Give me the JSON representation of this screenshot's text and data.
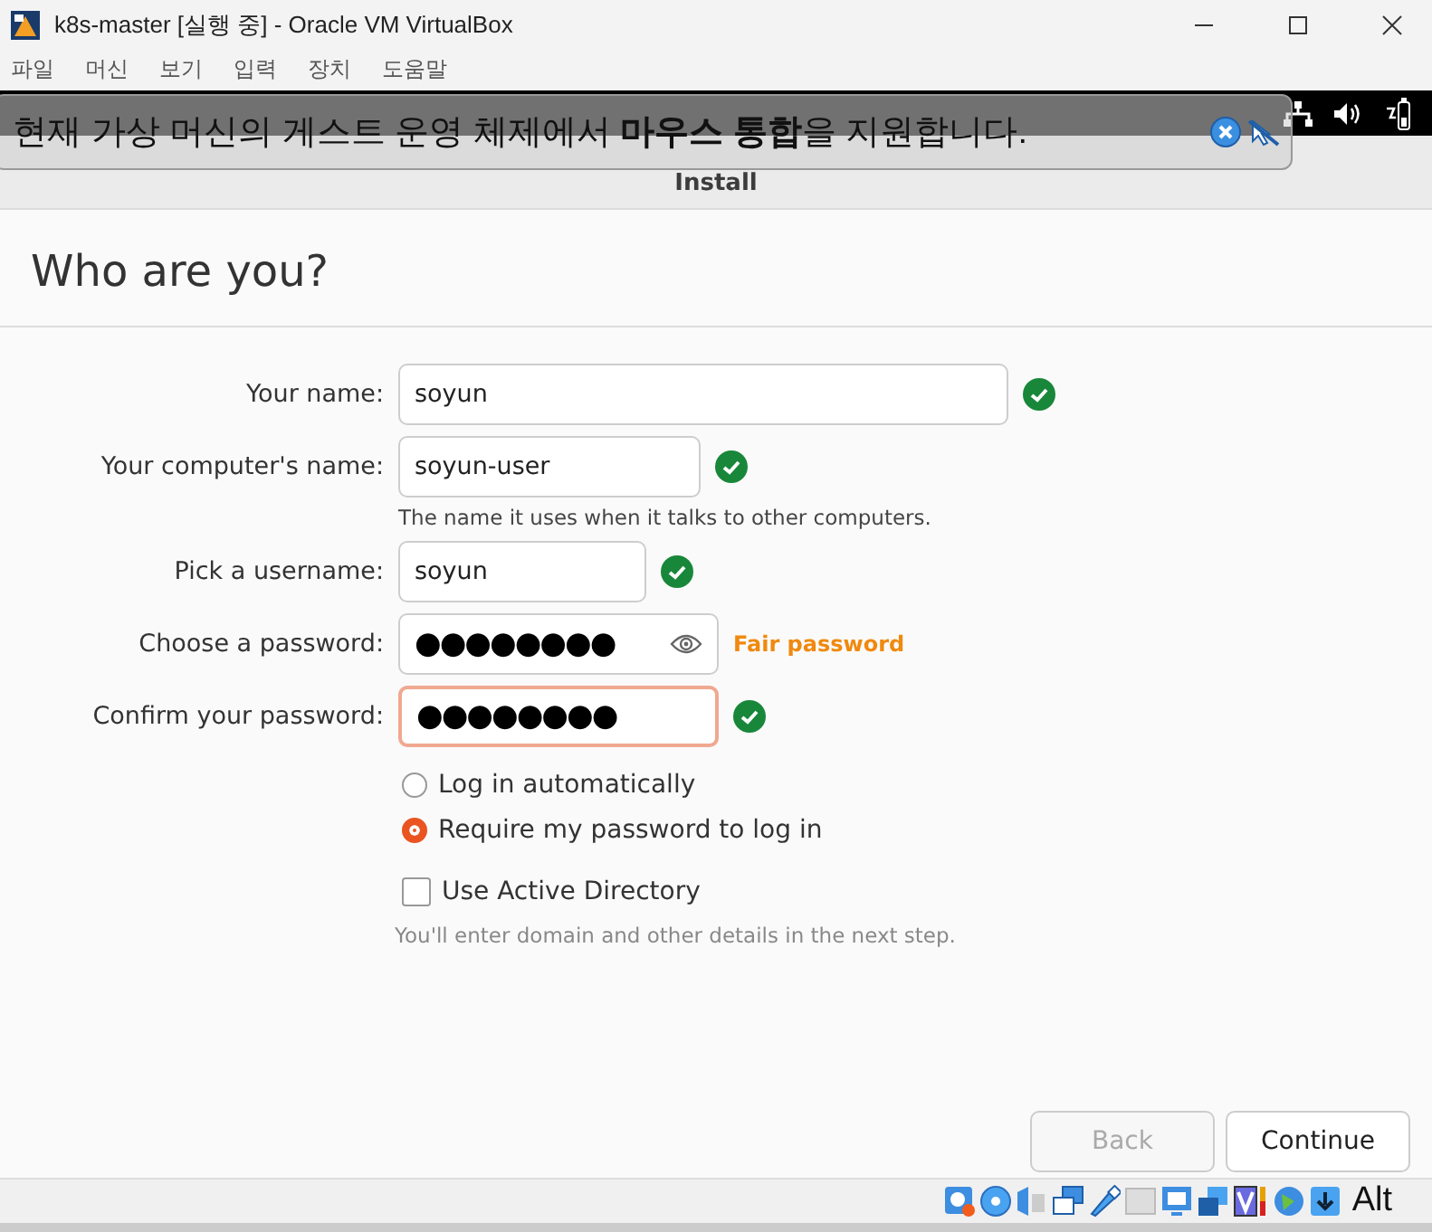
{
  "window": {
    "title": "k8s-master [실행 중] - Oracle VM VirtualBox"
  },
  "menu": [
    "파일",
    "머신",
    "보기",
    "입력",
    "장치",
    "도움말"
  ],
  "notification": {
    "text": "현재 가상 머신의 게스트 운영 체제에서 **마우스 통합**을 지원합니다."
  },
  "installer": {
    "title": "Install",
    "heading": "Who are you?",
    "fields": [
      {
        "label": "Your name:",
        "value": "soyun",
        "kind": "text",
        "valid": true,
        "focused": false
      },
      {
        "label": "Your computer's name:",
        "value": "soyun-user",
        "kind": "text",
        "valid": true,
        "focused": false,
        "hint": "The name it uses when it talks to other computers."
      },
      {
        "label": "Pick a username:",
        "value": "soyun",
        "kind": "text",
        "valid": true,
        "focused": false
      },
      {
        "label": "Choose a password:",
        "value": "●●●●●●●●",
        "kind": "password",
        "valid": false,
        "focused": false,
        "strength": "Fair password"
      },
      {
        "label": "Confirm your password:",
        "value": "●●●●●●●●",
        "kind": "text",
        "valid": true,
        "focused": true
      }
    ],
    "login_options": [
      {
        "label": "Log in automatically",
        "selected": false
      },
      {
        "label": "Require my password to log in",
        "selected": true
      }
    ],
    "active_directory": {
      "label": "Use Active Directory",
      "checked": false,
      "hint": "You'll enter domain and other details in the next step."
    },
    "buttons": [
      {
        "label": "Back",
        "disabled": true
      },
      {
        "label": "Continue",
        "disabled": false
      }
    ]
  },
  "status_bar": {
    "host_key": "Alt"
  }
}
